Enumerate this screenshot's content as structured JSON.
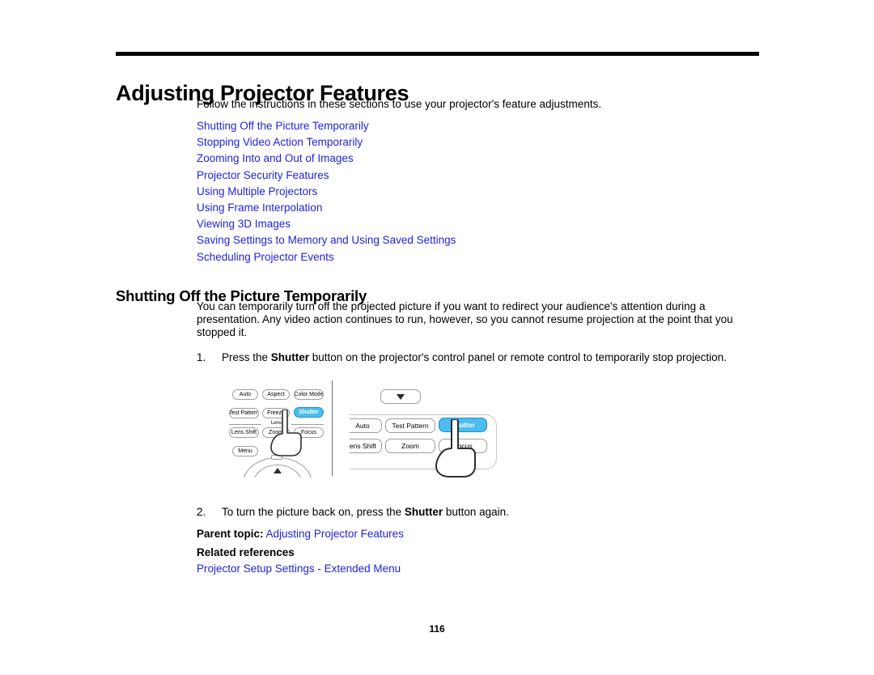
{
  "document": {
    "chapter_title": "Adjusting Projector Features",
    "intro": "Follow the instructions in these sections to use your projector's feature adjustments.",
    "page_number": "116"
  },
  "toc_links": [
    {
      "label": "Shutting Off the Picture Temporarily"
    },
    {
      "label": "Stopping Video Action Temporarily"
    },
    {
      "label": "Zooming Into and Out of Images"
    },
    {
      "label": "Projector Security Features"
    },
    {
      "label": "Using Multiple Projectors"
    },
    {
      "label": "Using Frame Interpolation"
    },
    {
      "label": "Viewing 3D Images"
    },
    {
      "label": "Saving Settings to Memory and Using Saved Settings"
    },
    {
      "label": "Scheduling Projector Events"
    }
  ],
  "section": {
    "heading": "Shutting Off the Picture Temporarily",
    "paragraph": "You can temporarily turn off the projected picture if you want to redirect your audience's attention during a presentation. Any video action continues to run, however, so you cannot resume projection at the point that you stopped it.",
    "steps": [
      {
        "number": "1.",
        "text_before": "Press the ",
        "bold": "Shutter",
        "text_after": " button on the projector's control panel or remote control to temporarily stop projection."
      },
      {
        "number": "2.",
        "text_before": "To turn the picture back on, press the ",
        "bold": "Shutter",
        "text_after": " button again."
      }
    ]
  },
  "figure": {
    "control_panel": {
      "keys": [
        {
          "label": "Auto"
        },
        {
          "label": "Aspect"
        },
        {
          "label": "Color Mode"
        },
        {
          "label": "Test Pattern"
        },
        {
          "label": "Freeze"
        },
        {
          "label": "Shutter"
        },
        {
          "label": "Lens Shift"
        },
        {
          "label": "Zoom"
        },
        {
          "label": "Focus"
        },
        {
          "label": "Menu"
        }
      ],
      "group_label": "Lens"
    },
    "detail_view": {
      "down_button_glyph": "▼",
      "keys": [
        {
          "label": "Auto"
        },
        {
          "label": "Test Pattern"
        },
        {
          "label": "Shutter"
        },
        {
          "label": "Lens Shift"
        },
        {
          "label": "Zoom"
        },
        {
          "label": "Focus"
        }
      ]
    },
    "highlight_color": "#4dbdef",
    "highlighted_key": "Shutter"
  },
  "footer": {
    "parent_topic_label": "Parent topic:",
    "parent_topic_link": "Adjusting Projector Features",
    "related_heading": "Related references",
    "related_link": "Projector Setup Settings - Extended Menu"
  }
}
